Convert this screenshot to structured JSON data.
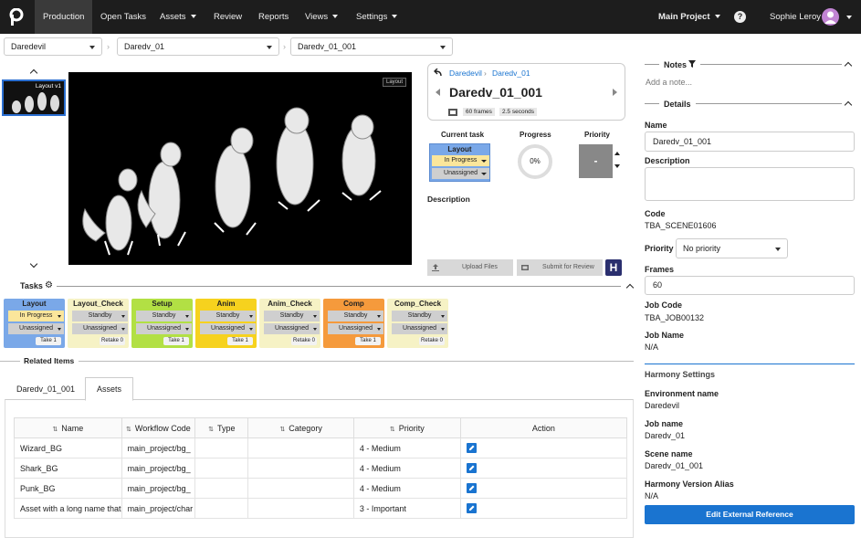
{
  "nav": {
    "items": [
      "Production",
      "Open Tasks",
      "Assets",
      "Review",
      "Reports",
      "Views",
      "Settings"
    ],
    "project": "Main Project",
    "help": "?",
    "user": "Sophie Leroy"
  },
  "breadcrumb_selects": [
    "Daredevil",
    "Daredv_01",
    "Daredv_01_001"
  ],
  "thumbnail": {
    "label": "Layout v1"
  },
  "viewer": {
    "badge": "Layout"
  },
  "shot": {
    "crumb_project": "Daredevil",
    "crumb_sep": "›",
    "crumb_seq": "Daredv_01",
    "name": "Daredv_01_001",
    "frames": "60 frames",
    "duration": "2.5 seconds"
  },
  "current_task": {
    "title": "Current task",
    "name": "Layout",
    "status": "In Progress",
    "assignee": "Unassigned"
  },
  "progress": {
    "title": "Progress",
    "value": "0%",
    "fraction": 0
  },
  "priority": {
    "title": "Priority",
    "value": "-"
  },
  "description_label": "Description",
  "buttons": {
    "upload": "Upload Files",
    "submit": "Submit for Review",
    "harmony": "H"
  },
  "tasks_title": "Tasks",
  "tasks": [
    {
      "name": "Layout",
      "status": "In Progress",
      "assignee": "Unassigned",
      "type": "Take",
      "count": "1",
      "color": "#7aa8e8",
      "status_bg": "#fbe69b"
    },
    {
      "name": "Layout_Check",
      "status": "Standby",
      "assignee": "Unassigned",
      "type": "Retake",
      "count": "0",
      "color": "#f6f2c5",
      "status_bg": "#cfcfcf"
    },
    {
      "name": "Setup",
      "status": "Standby",
      "assignee": "Unassigned",
      "type": "Take",
      "count": "1",
      "color": "#b2e044",
      "status_bg": "#cfcfcf"
    },
    {
      "name": "Anim",
      "status": "Standby",
      "assignee": "Unassigned",
      "type": "Take",
      "count": "1",
      "color": "#f6d21e",
      "status_bg": "#cfcfcf"
    },
    {
      "name": "Anim_Check",
      "status": "Standby",
      "assignee": "Unassigned",
      "type": "Retake",
      "count": "0",
      "color": "#f6f2c5",
      "status_bg": "#cfcfcf"
    },
    {
      "name": "Comp",
      "status": "Standby",
      "assignee": "Unassigned",
      "type": "Take",
      "count": "1",
      "color": "#f59a3c",
      "status_bg": "#cfcfcf"
    },
    {
      "name": "Comp_Check",
      "status": "Standby",
      "assignee": "Unassigned",
      "type": "Retake",
      "count": "0",
      "color": "#f6f2c5",
      "status_bg": "#cfcfcf"
    }
  ],
  "related_title": "Related Items",
  "related_tabs": [
    "Daredv_01_001",
    "Assets"
  ],
  "table": {
    "headers": [
      "Name",
      "Workflow Code",
      "Type",
      "Category",
      "Priority",
      "Action"
    ],
    "rows": [
      {
        "name": "Wizard_BG",
        "workflow": "main_project/bg_",
        "type": "",
        "category": "",
        "priority": "4 - Medium"
      },
      {
        "name": "Shark_BG",
        "workflow": "main_project/bg_",
        "type": "",
        "category": "",
        "priority": "4 - Medium"
      },
      {
        "name": "Punk_BG",
        "workflow": "main_project/bg_",
        "type": "",
        "category": "",
        "priority": "4 - Medium"
      },
      {
        "name": "Asset with a long name that",
        "workflow": "main_project/char",
        "type": "",
        "category": "",
        "priority": "3 - Important"
      }
    ]
  },
  "notes": {
    "title": "Notes",
    "placeholder": "Add a note..."
  },
  "details": {
    "title": "Details",
    "name_label": "Name",
    "name_value": "Daredv_01_001",
    "description_label": "Description",
    "code_label": "Code",
    "code_value": "TBA_SCENE01606",
    "priority_label": "Priority",
    "priority_value": "No priority",
    "frames_label": "Frames",
    "frames_value": "60",
    "job_code_label": "Job Code",
    "job_code_value": "TBA_JOB00132",
    "job_name_label": "Job Name",
    "job_name_value": "N/A"
  },
  "harmony": {
    "title": "Harmony Settings",
    "env_label": "Environment name",
    "env_value": "Daredevil",
    "job_label": "Job name",
    "job_value": "Daredv_01",
    "scene_label": "Scene name",
    "scene_value": "Daredv_01_001",
    "alias_label": "Harmony Version Alias",
    "alias_value": "N/A",
    "button": "Edit External Reference"
  },
  "colors": {
    "accent": "#1a74d0",
    "nav_bg": "#1d1d1d",
    "harmony_blue": "#2a2f6e"
  }
}
